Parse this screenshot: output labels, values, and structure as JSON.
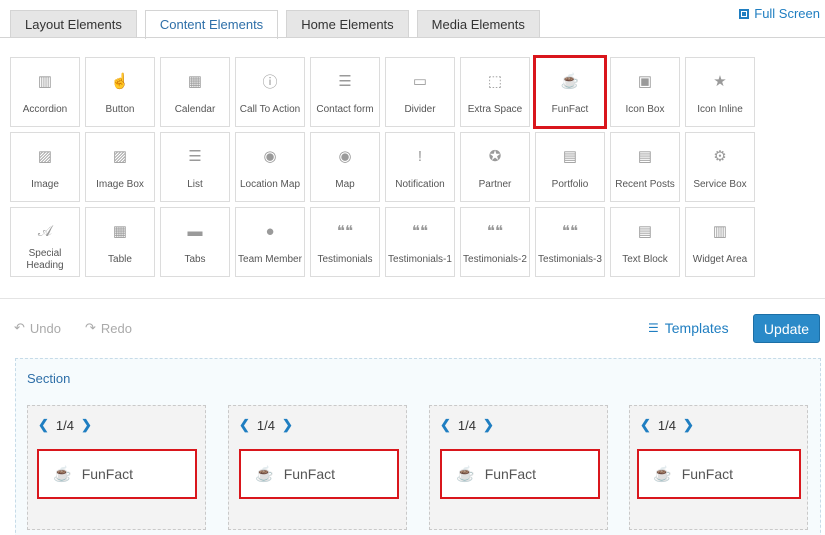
{
  "tabs": [
    {
      "label": "Layout Elements",
      "active": false
    },
    {
      "label": "Content Elements",
      "active": true
    },
    {
      "label": "Home Elements",
      "active": false
    },
    {
      "label": "Media Elements",
      "active": false
    }
  ],
  "full_screen_label": "Full Screen",
  "elements": [
    {
      "label": "Accordion",
      "icon": "map-icon",
      "glyph": "▥"
    },
    {
      "label": "Button",
      "icon": "hand-pointer-icon",
      "glyph": "☝"
    },
    {
      "label": "Calendar",
      "icon": "calendar-icon",
      "glyph": "▦"
    },
    {
      "label": "Call To Action",
      "icon": "info-icon",
      "glyph": "ⓘ"
    },
    {
      "label": "Contact form",
      "icon": "form-icon",
      "glyph": "☰"
    },
    {
      "label": "Divider",
      "icon": "divider-icon",
      "glyph": "▭"
    },
    {
      "label": "Extra Space",
      "icon": "extra-space-icon",
      "glyph": "⬚"
    },
    {
      "label": "FunFact",
      "icon": "coffee-cup-icon",
      "glyph": "☕"
    },
    {
      "label": "Icon Box",
      "icon": "star-box-icon",
      "glyph": "▣"
    },
    {
      "label": "Icon Inline",
      "icon": "star-icon",
      "glyph": "★"
    },
    {
      "label": "Image",
      "icon": "image-icon",
      "glyph": "▨"
    },
    {
      "label": "Image Box",
      "icon": "image-box-icon",
      "glyph": "▨"
    },
    {
      "label": "List",
      "icon": "list-icon",
      "glyph": "☰"
    },
    {
      "label": "Location Map",
      "icon": "map-pin-icon",
      "glyph": "◉"
    },
    {
      "label": "Map",
      "icon": "map-marker-icon",
      "glyph": "◉"
    },
    {
      "label": "Notification",
      "icon": "exclamation-icon",
      "glyph": "!"
    },
    {
      "label": "Partner",
      "icon": "award-icon",
      "glyph": "✪"
    },
    {
      "label": "Portfolio",
      "icon": "portfolio-icon",
      "glyph": "▤"
    },
    {
      "label": "Recent Posts",
      "icon": "posts-icon",
      "glyph": "▤"
    },
    {
      "label": "Service Box",
      "icon": "gear-icon",
      "glyph": "⚙"
    },
    {
      "label": "Special Heading",
      "icon": "font-icon",
      "glyph": "𝒜"
    },
    {
      "label": "Table",
      "icon": "table-icon",
      "glyph": "▦"
    },
    {
      "label": "Tabs",
      "icon": "folder-icon",
      "glyph": "▬"
    },
    {
      "label": "Team Member",
      "icon": "user-icon",
      "glyph": "●"
    },
    {
      "label": "Testimonials",
      "icon": "quote-icon",
      "glyph": "❝❝"
    },
    {
      "label": "Testimonials-1",
      "icon": "quote-icon",
      "glyph": "❝❝"
    },
    {
      "label": "Testimonials-2",
      "icon": "quote-icon",
      "glyph": "❝❝"
    },
    {
      "label": "Testimonials-3",
      "icon": "quote-icon",
      "glyph": "❝❝"
    },
    {
      "label": "Text Block",
      "icon": "text-block-icon",
      "glyph": "▤"
    },
    {
      "label": "Widget Area",
      "icon": "widget-icon",
      "glyph": "▥"
    }
  ],
  "highlighted_element": "FunFact",
  "toolbar": {
    "undo_label": "Undo",
    "redo_label": "Redo",
    "templates_label": "Templates",
    "update_label": "Update"
  },
  "section": {
    "label": "Section",
    "columns": [
      {
        "fraction": "1/4",
        "element": "FunFact"
      },
      {
        "fraction": "1/4",
        "element": "FunFact"
      },
      {
        "fraction": "1/4",
        "element": "FunFact"
      },
      {
        "fraction": "1/4",
        "element": "FunFact"
      }
    ]
  },
  "colors": {
    "accent": "#1f7ec1",
    "highlight": "#d9161c",
    "button": "#2a8ac8"
  }
}
